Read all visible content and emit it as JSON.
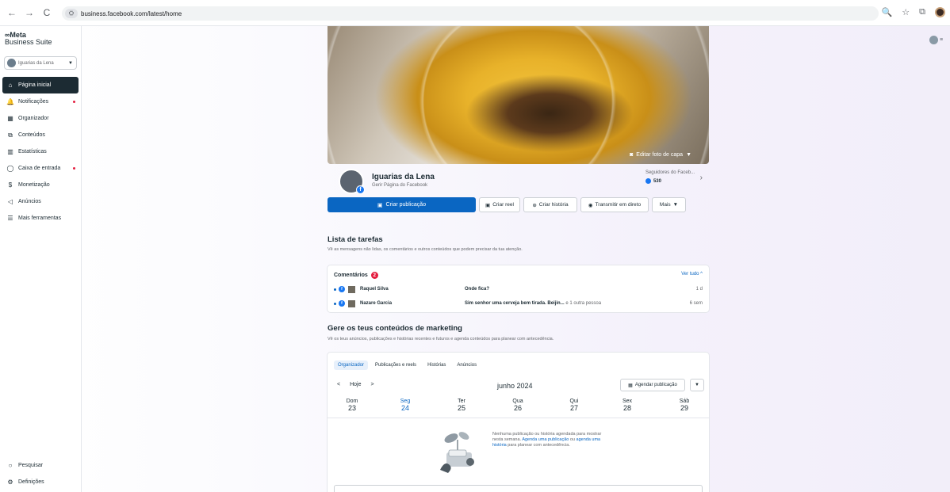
{
  "browser": {
    "url": "business.facebook.com/latest/home",
    "back_icon": "←",
    "forward_icon": "→",
    "reload_icon": "C",
    "site_info_icon": "⛭",
    "zoom_icon": "🔍",
    "star_icon": "☆",
    "extensions_icon": "⧉"
  },
  "sidebar": {
    "brand_line1": "Meta",
    "brand_line2": "Business Suite",
    "account_name": "Iguarias da Lena",
    "account_caret": "▼",
    "items": [
      {
        "label": "Página inicial",
        "icon": "home-icon",
        "glyph": "⌂"
      },
      {
        "label": "Notificações",
        "icon": "bell-icon",
        "glyph": "🔔"
      },
      {
        "label": "Organizador",
        "icon": "calendar-icon",
        "glyph": "▦"
      },
      {
        "label": "Conteúdos",
        "icon": "content-icon",
        "glyph": "⧉"
      },
      {
        "label": "Estatísticas",
        "icon": "chart-icon",
        "glyph": "▥"
      },
      {
        "label": "Caixa de entrada",
        "icon": "inbox-icon",
        "glyph": "◯"
      },
      {
        "label": "Monetização",
        "icon": "money-icon",
        "glyph": "$"
      },
      {
        "label": "Anúncios",
        "icon": "megaphone-icon",
        "glyph": "◁"
      },
      {
        "label": "Mais ferramentas",
        "icon": "menu-icon",
        "glyph": "☰"
      }
    ],
    "bottom": [
      {
        "label": "Pesquisar",
        "icon": "search-icon",
        "glyph": "○"
      },
      {
        "label": "Definições",
        "icon": "gear-icon",
        "glyph": "⚙"
      }
    ]
  },
  "page": {
    "edit_cover": "Editar foto de capa",
    "edit_cover_caret": "▼",
    "name": "Iguarias da Lena",
    "subtitle": "Gerir Página do Facebook",
    "followers_label": "Seguidores do Faceb...",
    "followers_count": "530",
    "followers_chevron": "›"
  },
  "actions": {
    "create_post": "Criar publicação",
    "create_reel": "Criar reel",
    "create_story": "Criar história",
    "go_live": "Transmitir em direto",
    "more": "Mais",
    "more_caret": "▼"
  },
  "tasks": {
    "title": "Lista de tarefas",
    "description": "Vê as mensagens não lidas, os comentários e outros conteúdos que podem precisar da tua atenção.",
    "comments_label": "Comentários",
    "comments_badge": "2",
    "see_all": "Ver tudo",
    "see_all_caret": "^",
    "rows": [
      {
        "author": "Raquel Silva",
        "message": "Onde fica?",
        "rest": "",
        "time": "1 d"
      },
      {
        "author": "Nazare Garcia",
        "message": "Sim senhor uma cerveja bem tirada. Beijin...",
        "rest": "e 1 outra pessoa",
        "time": "6 sem"
      }
    ]
  },
  "marketing": {
    "title": "Gere os teus conteúdos de marketing",
    "description": "Vê os teus anúncios, publicações e histórias recentes e futuros e agenda conteúdos para planear com antecedência.",
    "tabs": [
      "Organizador",
      "Publicações e reels",
      "Histórias",
      "Anúncios"
    ],
    "prev": "<",
    "today": "Hoje",
    "next": ">",
    "month": "junho 2024",
    "schedule": "Agendar publicação",
    "schedule_caret": "▼",
    "days": [
      {
        "name": "Dom",
        "num": "23"
      },
      {
        "name": "Seg",
        "num": "24"
      },
      {
        "name": "Ter",
        "num": "25"
      },
      {
        "name": "Qua",
        "num": "26"
      },
      {
        "name": "Qui",
        "num": "27"
      },
      {
        "name": "Sex",
        "num": "28"
      },
      {
        "name": "Sáb",
        "num": "29"
      }
    ],
    "empty_text_1": "Nenhuma publicação ou história agendada para mostrar nesta semana.",
    "empty_link_1": "Agenda uma publicação",
    "empty_text_2": "ou",
    "empty_link_2": "agenda uma história",
    "empty_text_3": "para planear com antecedência."
  },
  "colors": {
    "accent": "#0a66c2",
    "facebook": "#1877f2",
    "alert": "#e41e3f",
    "dark": "#1c2b33"
  }
}
